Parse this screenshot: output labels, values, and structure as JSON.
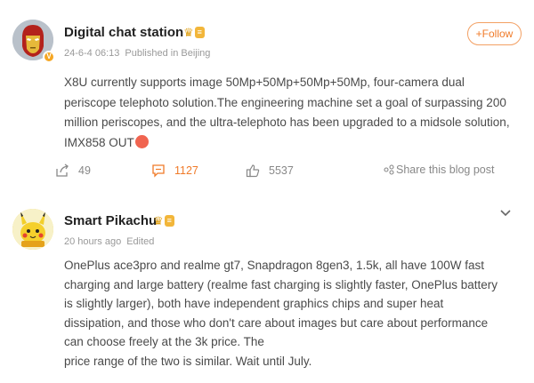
{
  "posts": [
    {
      "author": "Digital chat station",
      "rank_tag": "≡",
      "verified_glyph": "V",
      "date": "24-6-4 06:13",
      "location": "Published in Beijing",
      "follow_label": "+Follow",
      "text": "X8U currently supports image 50Mp+50Mp+50Mp+50Mp, four-camera dual periscope telephoto solution.The engineering machine set a goal of surpassing 200 million periscopes, and the ultra-telephoto has been upgraded to a midsole solution, IMX858 OUT",
      "actions": {
        "share_count": "49",
        "comment_count": "1127",
        "like_count": "5537",
        "share_blog_label": "Share this blog post"
      },
      "icons": {
        "avatar": "iron-man-avatar",
        "share": "share-arrow-icon",
        "comment": "comment-bubble-icon",
        "like": "thumbs-up-icon",
        "emoji": "emoji-icon"
      }
    },
    {
      "author": "Smart Pikachu",
      "rank_tag": "≡",
      "time": "20 hours ago",
      "edited": "Edited",
      "text_lines": [
        "OnePlus ace3pro and realme gt7, Snapdragon 8gen3, 1.5k, all have 100W fast",
        "charging and large battery (realme fast charging is slightly faster, OnePlus battery",
        "is slightly larger), both have independent graphics chips and super heat",
        "dissipation, and those who don't care about images but care about performance",
        "can choose freely at the 3k price. The",
        "price range of the two is similar. Wait until July."
      ],
      "icons": {
        "avatar": "pikachu-avatar",
        "menu": "chevron-down-icon"
      }
    }
  ],
  "colors": {
    "accent": "#f07a28",
    "muted": "#999999",
    "badge_gold": "#f2b63a"
  }
}
